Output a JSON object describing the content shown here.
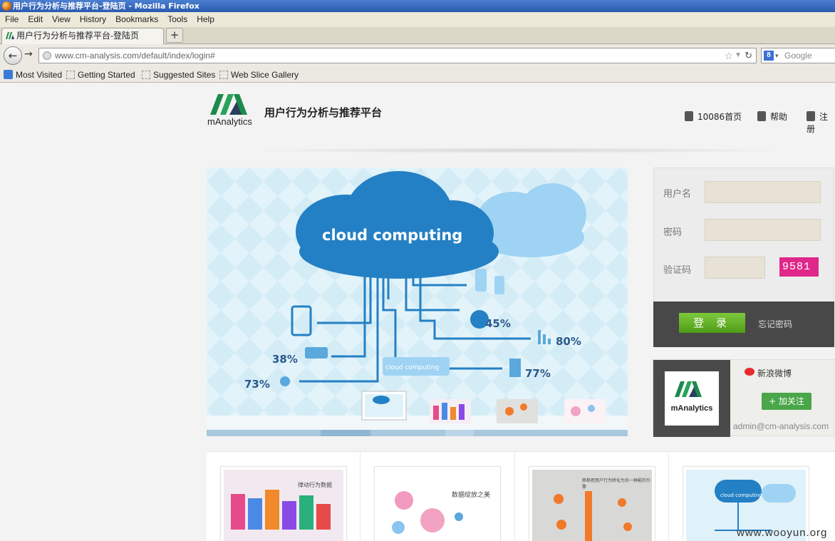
{
  "window": {
    "title": "用户行为分析与推荐平台-登陆页 - Mozilla Firefox"
  },
  "menu": [
    "File",
    "Edit",
    "View",
    "History",
    "Bookmarks",
    "Tools",
    "Help"
  ],
  "tab": {
    "label": "用户行为分析与推荐平台-登陆页",
    "new_tab": "+"
  },
  "nav": {
    "url": "www.cm-analysis.com/default/index/login#",
    "search_placeholder": "Google"
  },
  "bookmarks": [
    "Most Visited",
    "Getting Started",
    "Suggested Sites",
    "Web Slice Gallery"
  ],
  "header": {
    "logo_text": "mAnalytics",
    "site_title": "用户行为分析与推荐平台",
    "links": [
      "10086首页",
      "帮助",
      "注册"
    ]
  },
  "banner": {
    "cloud_title": "cloud computing",
    "small_cloud_label": "cloud computing",
    "stats": [
      "45%",
      "80%",
      "77%",
      "38%",
      "73%"
    ]
  },
  "login": {
    "username_label": "用户名",
    "password_label": "密码",
    "captcha_label": "验证码",
    "captcha_text": "9581",
    "login_button": "登 录",
    "forgot_link": "忘记密码"
  },
  "weibo": {
    "logo_text": "mAnalytics",
    "name": "新浪微博",
    "follow_button": "+ 加关注",
    "email": "admin@cm-analysis.com"
  },
  "cards": [
    {
      "caption": "律动行为数据"
    },
    {
      "caption": "数据绽放之美"
    },
    {
      "caption": "移移把用户行为转化为另一种能的引擎"
    },
    {
      "caption": "cloud computing"
    }
  ],
  "watermark": "www.wooyun.org"
}
